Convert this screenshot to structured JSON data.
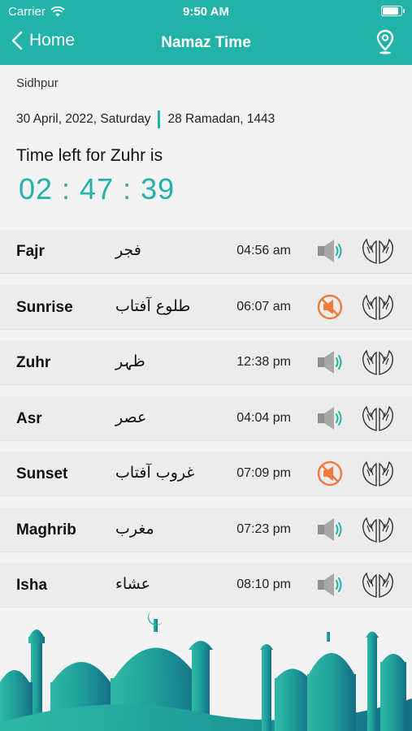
{
  "status_bar": {
    "carrier": "Carrier",
    "time": "9:50 AM",
    "battery_level": 0.92
  },
  "nav": {
    "back_label": "Home",
    "title": "Namaz Time",
    "location_icon": "map-pin-icon"
  },
  "location": {
    "city": "Sidhpur"
  },
  "dates": {
    "gregorian": "30 April, 2022, Saturday",
    "hijri": "28 Ramadan, 1443"
  },
  "countdown": {
    "label": "Time left for Zuhr is",
    "value": "02 : 47 : 39"
  },
  "prayers": [
    {
      "name": "Fajr",
      "arabic": "فجر",
      "time": "04:56 am",
      "sound": "on"
    },
    {
      "name": "Sunrise",
      "arabic": "طلوع آفتاب",
      "time": "06:07 am",
      "sound": "muted"
    },
    {
      "name": "Zuhr",
      "arabic": "ظہر",
      "time": "12:38 pm",
      "sound": "on"
    },
    {
      "name": "Asr",
      "arabic": "عصر",
      "time": "04:04 pm",
      "sound": "on"
    },
    {
      "name": "Sunset",
      "arabic": "غروب آفتاب",
      "time": "07:09 pm",
      "sound": "muted"
    },
    {
      "name": "Maghrib",
      "arabic": "مغرب",
      "time": "07:23 pm",
      "sound": "on"
    },
    {
      "name": "Isha",
      "arabic": "عشاء",
      "time": "08:10 pm",
      "sound": "on"
    }
  ],
  "colors": {
    "accent": "#22b3a8",
    "muted_icon": "#f07a3c",
    "row_bg": "#ececec",
    "page_bg": "#f3f3f3"
  }
}
